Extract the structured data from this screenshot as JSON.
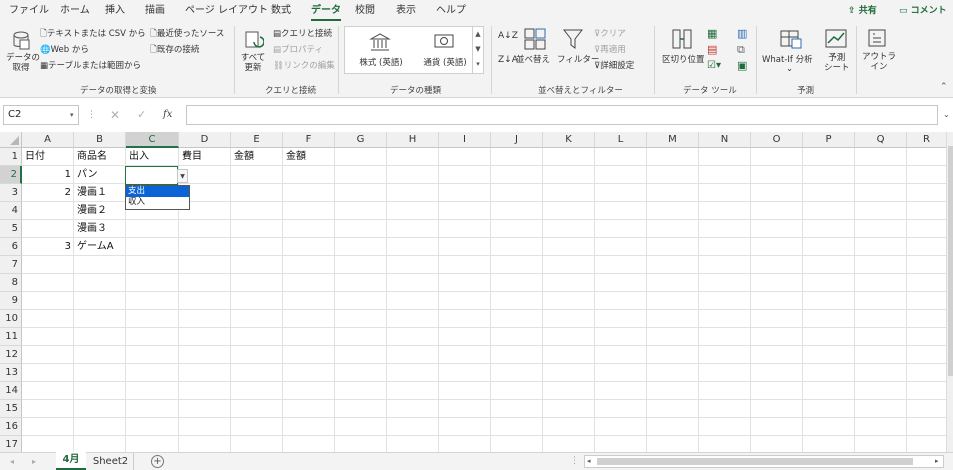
{
  "ribbon_tabs": [
    "ファイル",
    "ホーム",
    "挿入",
    "描画",
    "ページ レイアウト",
    "数式",
    "データ",
    "校閲",
    "表示",
    "ヘルプ"
  ],
  "active_tab": "データ",
  "share_label": "共有",
  "comment_label": "コメント",
  "ribbon": {
    "get_data": "データの\n取得",
    "from_text_csv": "テキストまたは CSV から",
    "from_web": "Web から",
    "from_table": "テーブルまたは範囲から",
    "recent_sources": "最近使ったソース",
    "existing_connections": "既存の接続",
    "group_get_transform": "データの取得と変換",
    "refresh_all": "すべて\n更新",
    "queries_connections": "クエリと接続",
    "properties": "プロパティ",
    "edit_links": "リンクの編集",
    "group_queries": "クエリと接続",
    "stocks": "株式 (英語)",
    "currencies": "通貨 (英語)",
    "group_data_types": "データの種類",
    "sort": "並べ替え",
    "filter": "フィルター",
    "clear": "クリア",
    "reapply": "再適用",
    "advanced": "詳細設定",
    "group_sort_filter": "並べ替えとフィルター",
    "text_to_columns": "区切り位置",
    "group_data_tools": "データ ツール",
    "what_if": "What-If 分析",
    "forecast_sheet": "予測\nシート",
    "group_forecast": "予測",
    "outline": "アウトラ\nイン"
  },
  "name_box": "C2",
  "formula_value": "",
  "fx_label": "fx",
  "columns": [
    "A",
    "B",
    "C",
    "D",
    "E",
    "F",
    "G",
    "H",
    "I",
    "J",
    "K",
    "L",
    "M",
    "N",
    "O",
    "P",
    "Q",
    "R"
  ],
  "rows": [
    "1",
    "2",
    "3",
    "4",
    "5",
    "6",
    "7",
    "8",
    "9",
    "10",
    "11",
    "12",
    "13",
    "14",
    "15",
    "16",
    "17"
  ],
  "cells": {
    "A1": "日付",
    "B1": "商品名",
    "C1": "出入",
    "D1": "費目",
    "E1": "金額",
    "F1": "金額",
    "A2": "1",
    "B2": "パン",
    "A3": "2",
    "B3": "漫画１",
    "B4": "漫画２",
    "B5": "漫画３",
    "A6": "3",
    "B6": "ゲームA"
  },
  "dropdown": {
    "options": [
      "支出",
      "収入"
    ],
    "highlighted": 0
  },
  "sheets": [
    "4月",
    "Sheet2"
  ],
  "active_sheet": 0,
  "accent": "#1e6b3c",
  "selection_color": "#217346"
}
